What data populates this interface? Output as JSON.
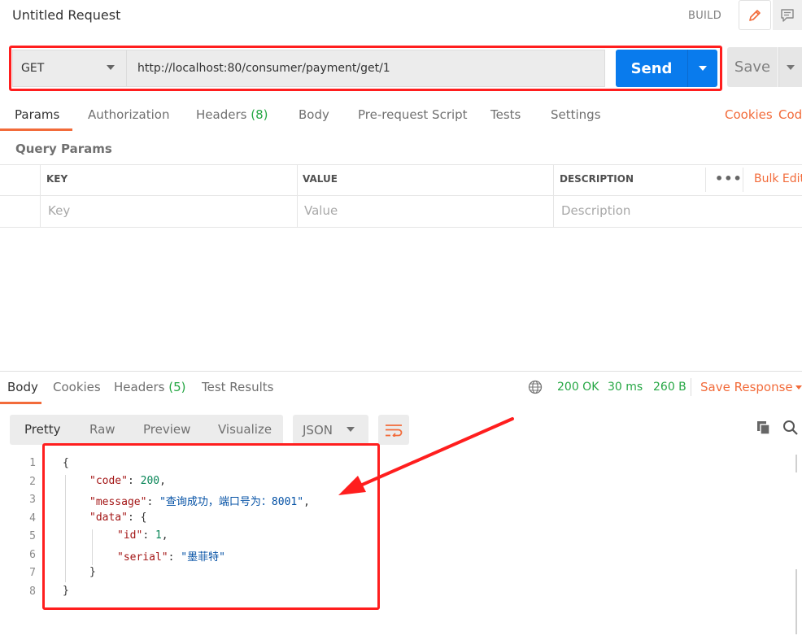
{
  "header": {
    "title": "Untitled Request",
    "build_label": "BUILD"
  },
  "request": {
    "method": "GET",
    "url": "http://localhost:80/consumer/payment/get/1",
    "send_label": "Send",
    "save_label": "Save"
  },
  "tabs": {
    "params": "Params",
    "authorization": "Authorization",
    "headers": "Headers",
    "headers_count": "(8)",
    "body": "Body",
    "pre_request": "Pre-request Script",
    "tests": "Tests",
    "settings": "Settings",
    "cookies": "Cookies",
    "code": "Code"
  },
  "query_params": {
    "title": "Query Params",
    "col_key": "KEY",
    "col_value": "VALUE",
    "col_description": "DESCRIPTION",
    "more": "•••",
    "bulk_edit": "Bulk Edit",
    "ph_key": "Key",
    "ph_value": "Value",
    "ph_description": "Description"
  },
  "response": {
    "tabs": {
      "body": "Body",
      "cookies": "Cookies",
      "headers": "Headers",
      "headers_count": "(5)",
      "test_results": "Test Results"
    },
    "status": "200 OK",
    "time": "30 ms",
    "size": "260 B",
    "save_response": "Save Response",
    "views": {
      "pretty": "Pretty",
      "raw": "Raw",
      "preview": "Preview",
      "visualize": "Visualize"
    },
    "format": "JSON",
    "code": {
      "line_numbers": [
        "1",
        "2",
        "3",
        "4",
        "5",
        "6",
        "7",
        "8"
      ],
      "l1": "{",
      "code_key": "\"code\"",
      "code_val": "200",
      "message_key": "\"message\"",
      "message_val": "\"查询成功，端口号为：8001\"",
      "data_key": "\"data\"",
      "data_open": "{",
      "id_key": "\"id\"",
      "id_val": "1",
      "serial_key": "\"serial\"",
      "serial_val": "\"墨菲特\"",
      "l7": "}",
      "l8": "}"
    }
  },
  "colors": {
    "accent": "#f26b3a",
    "send_blue": "#097bed",
    "status_green": "#26a744",
    "annotation_red": "#ff1e1e"
  }
}
